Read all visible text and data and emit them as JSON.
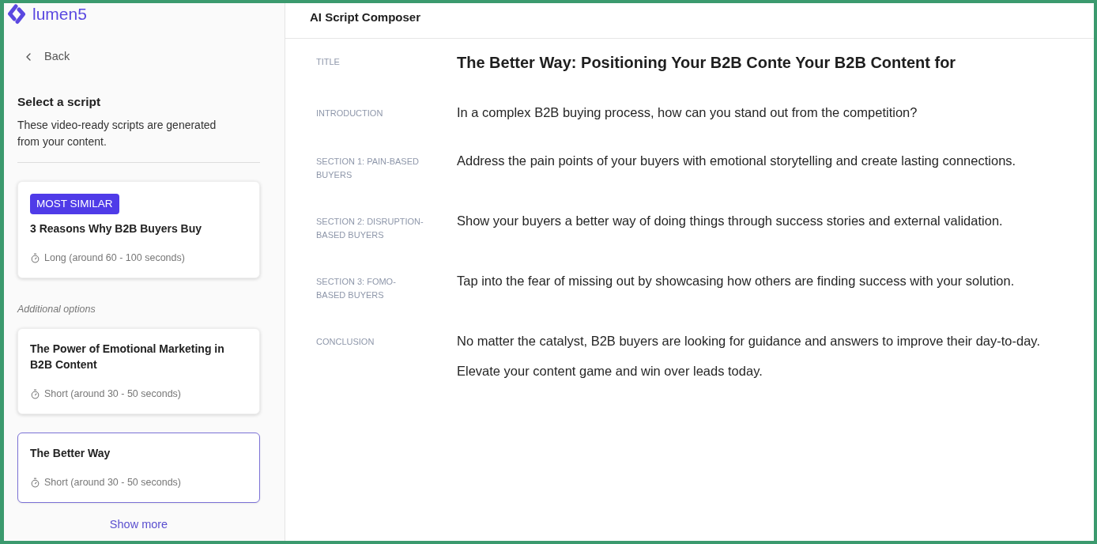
{
  "logo": {
    "text": "lumen5"
  },
  "back": {
    "label": "Back"
  },
  "sidebar": {
    "heading": "Select a script",
    "description": "These video-ready scripts are generated from your content.",
    "recommended": {
      "badge": "MOST SIMILAR",
      "title": "3 Reasons Why B2B Buyers Buy",
      "duration": "Long (around 60 - 100 seconds)",
      "selected": false
    },
    "additional_options": {
      "heading": "Additional options",
      "scripts": [
        {
          "title": "The Power of Emotional Marketing in B2B Content",
          "duration": "Short (around 30 - 50 seconds)",
          "selected": false
        },
        {
          "title": "The Better Way",
          "duration": "Short (around 30 - 50 seconds)",
          "selected": true
        }
      ]
    },
    "show_more": "Show more"
  },
  "composer": {
    "header": "AI Script Composer",
    "fields": [
      {
        "kind": "title",
        "label": "TITLE",
        "paragraphs": [
          "The Better Way: Positioning Your B2B Conte Your B2B Content for"
        ]
      },
      {
        "kind": "text",
        "label": "INTRODUCTION",
        "paragraphs": [
          "In a complex B2B buying process, how can you stand out from the competition?"
        ]
      },
      {
        "kind": "text",
        "label": "SECTION 1: PAIN-BASED BUYERS",
        "paragraphs": [
          "Address the pain points of your buyers with emotional storytelling and create lasting connections."
        ]
      },
      {
        "kind": "text",
        "label": "SECTION 2: DISRUPTION-BASED BUYERS",
        "paragraphs": [
          "Show your buyers a better way of doing things through success stories and external validation."
        ]
      },
      {
        "kind": "text",
        "label": "SECTION 3: FOMO-BASED BUYERS",
        "paragraphs": [
          "Tap into the fear of missing out by showcasing how others are finding success with your solution."
        ]
      },
      {
        "kind": "text",
        "label": "CONCLUSION",
        "paragraphs": [
          "No matter the catalyst, B2B buyers are looking for guidance and answers to improve their day-to-day.",
          "Elevate your content game and win over leads today."
        ]
      }
    ]
  }
}
